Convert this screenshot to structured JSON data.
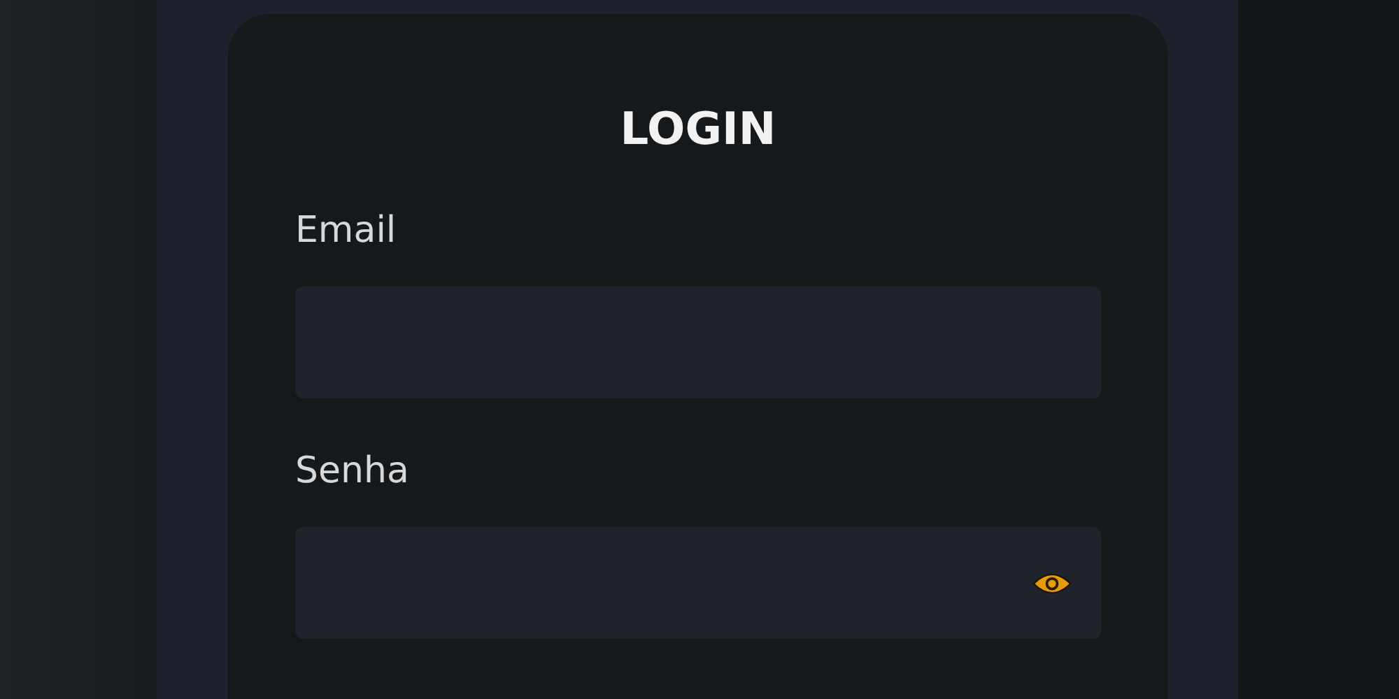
{
  "title": "LOGIN",
  "fields": [
    {
      "label": "Email",
      "kind": "text"
    },
    {
      "label": "Senha",
      "kind": "password"
    }
  ]
}
